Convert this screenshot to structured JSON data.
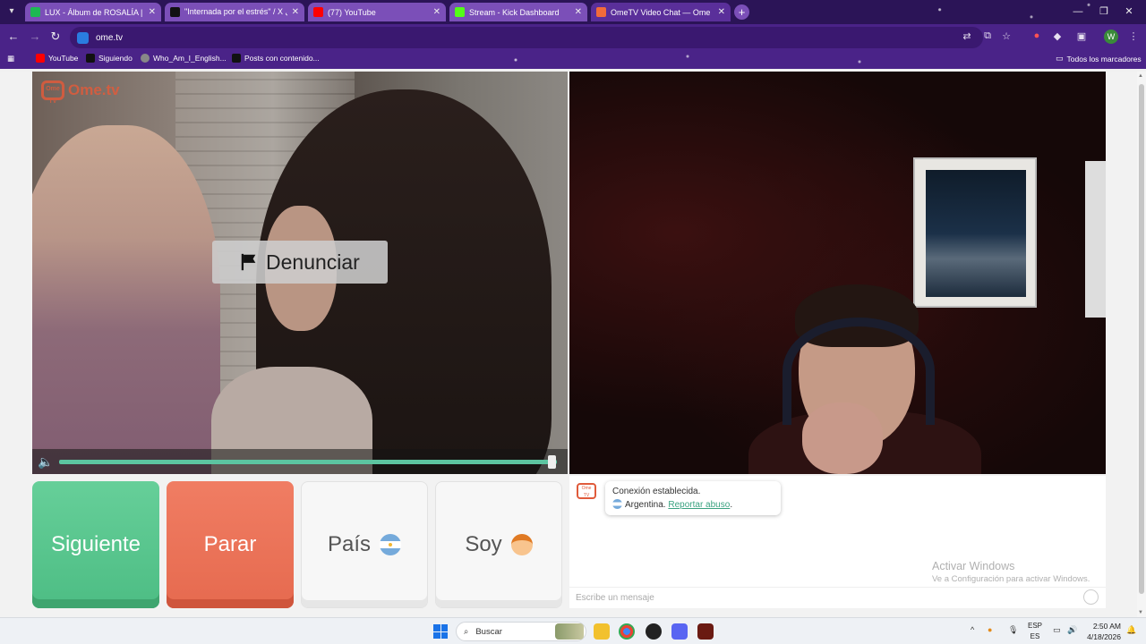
{
  "browser": {
    "tabs": [
      {
        "title": "LUX - Álbum de ROSALÍA | Spo",
        "favicon_color": "#1db954"
      },
      {
        "title": "\"Internada por el estrés\" / X نقل",
        "favicon_color": "#111111"
      },
      {
        "title": "(77) YouTube",
        "favicon_color": "#ff0000"
      },
      {
        "title": "Stream - Kick Dashboard",
        "favicon_color": "#53fc18"
      },
      {
        "title": "OmeTV Video Chat — Ome",
        "favicon_color": "#f26b3a"
      }
    ],
    "url": "ome.tv",
    "bookmarks": [
      {
        "label": "YouTube",
        "icon_color": "#ff0000"
      },
      {
        "label": "Siguiendo",
        "icon_color": "#111111"
      },
      {
        "label": "Who_Am_I_English...",
        "icon_color": "#888888"
      },
      {
        "label": "Posts con contenido...",
        "icon_color": "#111111"
      }
    ],
    "all_bookmarks": "Todos los marcadores",
    "profile_initial": "W"
  },
  "video": {
    "logo_text": "Ome.tv",
    "logo_badge": "Ome TV",
    "report_label": "Denunciar",
    "volume_level": 0.99
  },
  "controls": {
    "next_label": "Siguiente",
    "stop_label": "Parar",
    "country_label": "País",
    "gender_label": "Soy"
  },
  "chat": {
    "connection_text": "Conexión establecida.",
    "country_text": "Argentina.",
    "report_link": "Reportar abuso",
    "input_placeholder": "Escribe un mensaje",
    "watermark_title": "Activar Windows",
    "watermark_sub": "Ve a Configuración para activar Windows."
  },
  "taskbar": {
    "search_label": "Buscar",
    "lang_top": "ESP",
    "lang_bottom": "ES",
    "time": "2:50 AM",
    "date": "4/18/2026"
  },
  "colors": {
    "next_green": "#5cc78f",
    "stop_red": "#ea6f54",
    "accent_link": "#3aa280",
    "browser_purple": "#4a2388"
  }
}
